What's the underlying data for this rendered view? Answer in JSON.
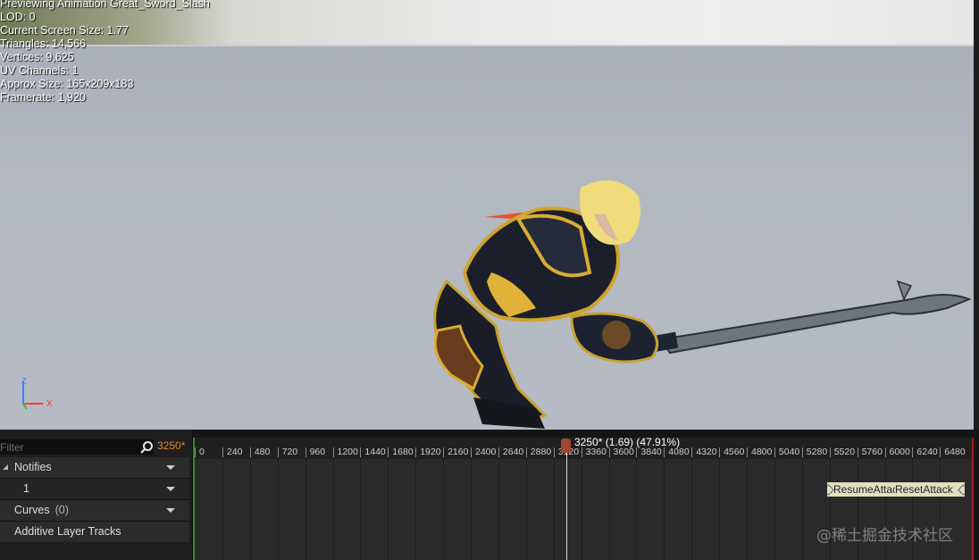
{
  "viewport": {
    "stats": [
      "Previewing Animation Great_Sword_Slash",
      "LOD: 0",
      "Current Screen Size: 1.77",
      "Triangles: 14,566",
      "Vertices: 9,625",
      "UV Channels: 1",
      "Approx Size: 165x209x183",
      "Framerate: 1,920"
    ],
    "axis": {
      "z": "Z",
      "x": "X"
    }
  },
  "timeline": {
    "filter_placeholder": "Filter",
    "current_frame": "3250*",
    "tracks": {
      "notifies": "Notifies",
      "notify_track_1": "1",
      "curves": "Curves",
      "curves_count": "(0)",
      "additive": "Additive Layer Tracks"
    },
    "ruler_ticks": [
      "0",
      "240",
      "480",
      "720",
      "960",
      "1200",
      "1440",
      "1680",
      "1920",
      "2160",
      "2400",
      "2640",
      "2880",
      "3120",
      "3360",
      "3600",
      "3840",
      "4080",
      "4320",
      "4560",
      "4800",
      "5040",
      "5280",
      "5520",
      "5760",
      "6000",
      "6240",
      "6480"
    ],
    "playhead_label": "3250* (1.69) (47.91%)",
    "notifies": [
      {
        "label": "ResumeAttack"
      },
      {
        "label": "ResetAttack"
      }
    ]
  },
  "watermark": "@稀土掘金技术社区",
  "icons": [
    "search-icon",
    "axis-gizmo-icon",
    "dropdown-arrow-icon",
    "expander-icon"
  ],
  "colors": {
    "current_frame": "#e08c2c",
    "playhead": "#a0472f",
    "notify": "#e2e0c0"
  }
}
